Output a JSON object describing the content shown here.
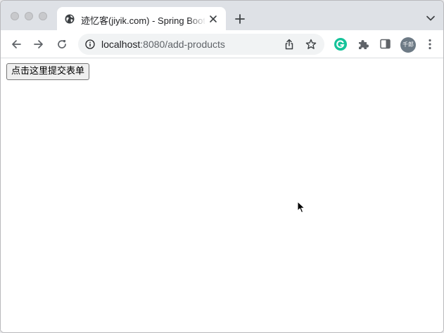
{
  "browser": {
    "tab": {
      "title": "迹忆客(jiyik.com) - Spring Boot",
      "favicon": "globe-icon"
    },
    "address_bar": {
      "host": "localhost",
      "path": ":8080/add-products"
    },
    "profile": {
      "initials": "千郎"
    },
    "colors": {
      "tabstrip": "#dee1e6",
      "omnibox": "#f1f3f4",
      "grammarly": "#15c39a",
      "avatar": "#6d7a85"
    }
  },
  "page": {
    "submit_button_label": "点击这里提交表单"
  }
}
